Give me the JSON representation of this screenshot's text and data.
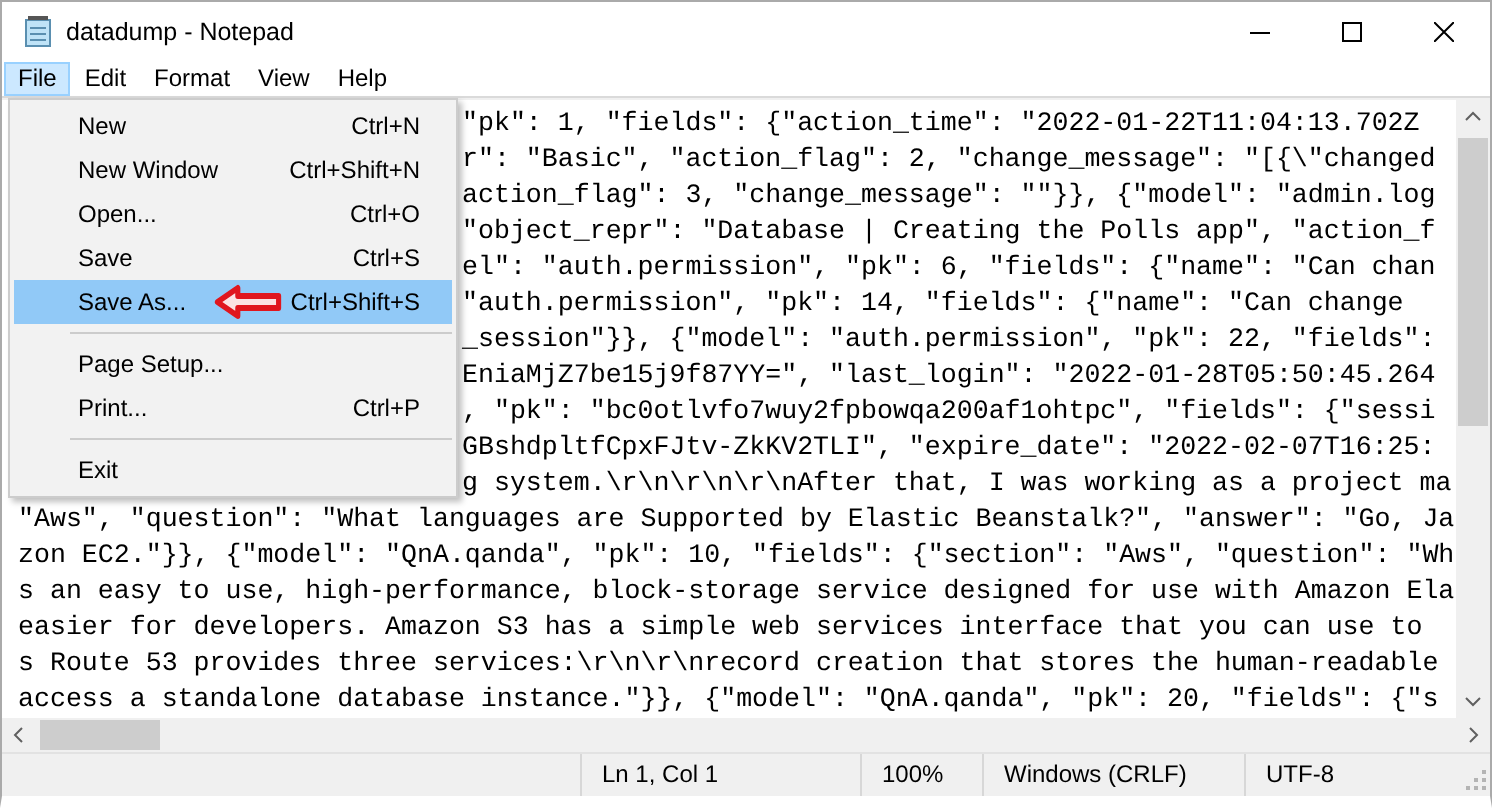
{
  "window": {
    "title": "datadump - Notepad"
  },
  "menu_bar": [
    {
      "label": "File",
      "selected": true
    },
    {
      "label": "Edit",
      "selected": false
    },
    {
      "label": "Format",
      "selected": false
    },
    {
      "label": "View",
      "selected": false
    },
    {
      "label": "Help",
      "selected": false
    }
  ],
  "file_menu": [
    {
      "kind": "item",
      "label": "New",
      "shortcut": "Ctrl+N",
      "selected": false
    },
    {
      "kind": "item",
      "label": "New Window",
      "shortcut": "Ctrl+Shift+N",
      "selected": false
    },
    {
      "kind": "item",
      "label": "Open...",
      "shortcut": "Ctrl+O",
      "selected": false
    },
    {
      "kind": "item",
      "label": "Save",
      "shortcut": "Ctrl+S",
      "selected": false
    },
    {
      "kind": "item",
      "label": "Save As...",
      "shortcut": "Ctrl+Shift+S",
      "selected": true
    },
    {
      "kind": "separator"
    },
    {
      "kind": "item",
      "label": "Page Setup...",
      "selected": false
    },
    {
      "kind": "item",
      "label": "Print...",
      "shortcut": "Ctrl+P",
      "selected": false
    },
    {
      "kind": "separator"
    },
    {
      "kind": "item",
      "label": "Exit",
      "selected": false
    }
  ],
  "editor": {
    "lines_beside_menu": [
      "\"pk\": 1, \"fields\": {\"action_time\": \"2022-01-22T11:04:13.702Z",
      "r\": \"Basic\", \"action_flag\": 2, \"change_message\": \"[{\\\"changed",
      "action_flag\": 3, \"change_message\": \"\"}}, {\"model\": \"admin.log",
      "\"object_repr\": \"Database | Creating the Polls app\", \"action_f",
      "el\": \"auth.permission\", \"pk\": 6, \"fields\": {\"name\": \"Can chan",
      "\"auth.permission\", \"pk\": 14, \"fields\": {\"name\": \"Can change",
      "_session\"}}, {\"model\": \"auth.permission\", \"pk\": 22, \"fields\":",
      "EniaMjZ7be15j9f87YY=\", \"last_login\": \"2022-01-28T05:50:45.264",
      ", \"pk\": \"bc0otlvfo7wuy2fpbowqa200af1ohtpc\", \"fields\": {\"sessi",
      "GBshdpltfCpxFJtv-ZkKV2TLI\", \"expire_date\": \"2022-02-07T16:25:",
      "g system.\\r\\n\\r\\n\\r\\nAfter that, I was working as a project ma"
    ],
    "lines": [
      "\"Aws\", \"question\": \"What languages are Supported by Elastic Beanstalk?\", \"answer\": \"Go, Ja",
      "zon EC2.\"}}, {\"model\": \"QnA.qanda\", \"pk\": 10, \"fields\": {\"section\": \"Aws\", \"question\": \"Wh",
      "s an easy to use, high-performance, block-storage service designed for use with Amazon Ela",
      "easier for developers. Amazon S3 has a simple web services interface that you can use to",
      "s Route 53 provides three services:\\r\\n\\r\\nrecord creation that stores the human-readable",
      "access a standalone database instance.\"}}, {\"model\": \"QnA.qanda\", \"pk\": 20, \"fields\": {\"s"
    ]
  },
  "status_bar": {
    "position": "Ln 1, Col 1",
    "zoom": "100%",
    "line_ending": "Windows (CRLF)",
    "encoding": "UTF-8"
  }
}
